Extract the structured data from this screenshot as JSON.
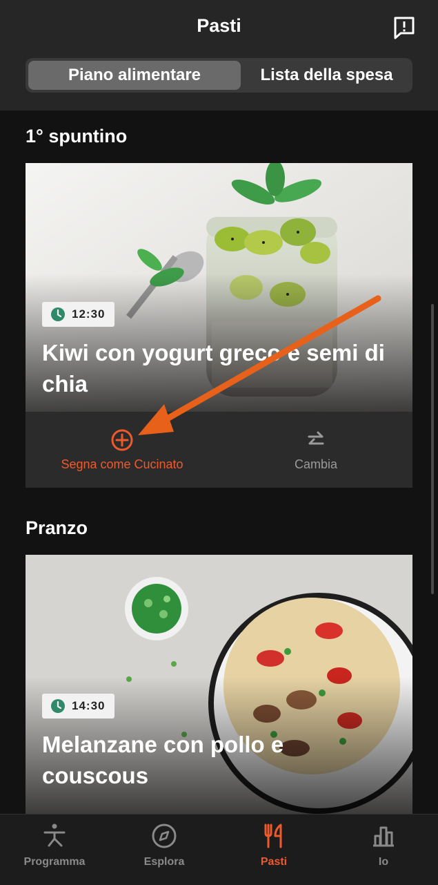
{
  "header": {
    "title": "Pasti"
  },
  "tabs": {
    "active": "Piano alimentare",
    "inactive": "Lista della spesa"
  },
  "sections": [
    {
      "title": "1° spuntino",
      "time": "12:30",
      "meal": "Kiwi con yogurt greco e semi di chia",
      "actions": {
        "cooked": "Segna come Cucinato",
        "change": "Cambia"
      }
    },
    {
      "title": "Pranzo",
      "time": "14:30",
      "meal": "Melanzane con pollo e couscous"
    }
  ],
  "bottom_nav": [
    {
      "label": "Programma",
      "icon": "exercise-figure-icon"
    },
    {
      "label": "Esplora",
      "icon": "compass-icon"
    },
    {
      "label": "Pasti",
      "icon": "fork-knife-icon"
    },
    {
      "label": "Io",
      "icon": "bar-chart-icon"
    }
  ],
  "colors": {
    "accent": "#ef5a2c",
    "clock": "#2f8a6a",
    "background": "#121212"
  }
}
